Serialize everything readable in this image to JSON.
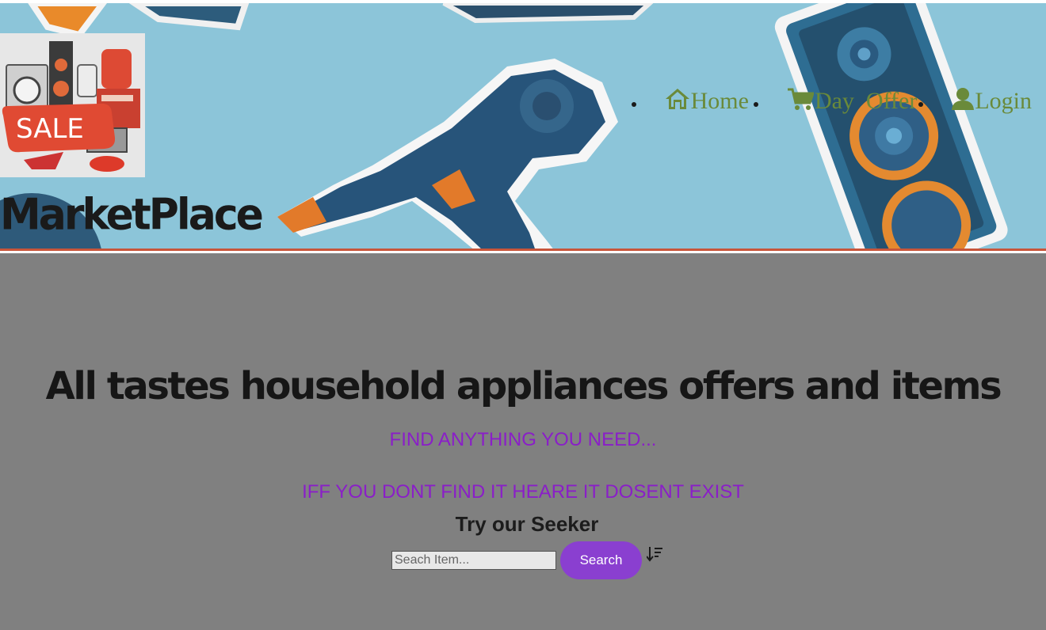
{
  "brand": {
    "title": "MarketPlace",
    "logo_text": "SALE"
  },
  "nav": {
    "items": [
      {
        "label": "Home",
        "icon": "home-icon"
      },
      {
        "label": "Day  Offer",
        "icon": "cart-icon"
      },
      {
        "label": "Login",
        "icon": "user-icon"
      }
    ]
  },
  "hero": {
    "heading": "All tastes household appliances offers and items",
    "tagline_1": "FIND ANYTHING YOU NEED...",
    "tagline_2": "IFF YOU DONT FIND IT HEARE IT DOSENT EXIST",
    "seeker_title": "Try our Seeker"
  },
  "search": {
    "placeholder": "Seach Item...",
    "value": "",
    "button_label": "Search",
    "sort_icon": "sort-descending-icon"
  },
  "colors": {
    "header_bg": "#8cc5d9",
    "main_bg": "#808080",
    "nav_text": "#6a8a3a",
    "tagline": "#8a1ec8",
    "search_button": "#8a3fd0",
    "header_border": "#c8553a"
  }
}
